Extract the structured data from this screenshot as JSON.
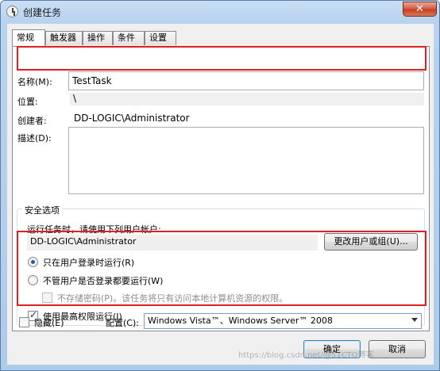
{
  "window": {
    "title": "创建任务",
    "close_label": "✕"
  },
  "tabs": [
    {
      "label": "常规"
    },
    {
      "label": "触发器"
    },
    {
      "label": "操作"
    },
    {
      "label": "条件"
    },
    {
      "label": "设置"
    }
  ],
  "general": {
    "name_label": "名称(M):",
    "name_value": "TestTask",
    "location_label": "位置:",
    "location_value": "\\",
    "author_label": "创建者:",
    "author_value": "DD-LOGIC\\Administrator",
    "description_label": "描述(D):",
    "description_value": ""
  },
  "security": {
    "group_title": "安全选项",
    "run_as_prompt": "运行任务时，请使用下列用户帐户:",
    "account_value": "DD-LOGIC\\Administrator",
    "change_user_button": "更改用户或组(U)...",
    "radio_logged_on": "只在用户登录时运行(R)",
    "radio_whether_logged_on": "不管用户是否登录都要运行(W)",
    "no_store_password": "不存储密码(P)。该任务将只有访问本地计算机资源的权限。",
    "highest_privileges": "使用最高权限运行(I)",
    "radio_logged_on_checked": true,
    "highest_privileges_checked": true
  },
  "footer": {
    "hidden_label": "隐藏(E)",
    "hidden_checked": false,
    "configure_label": "配置(C):",
    "configure_value": "Windows Vista™、Windows Server™ 2008",
    "ok_button": "确定",
    "cancel_button": "取消"
  },
  "watermark": "https://blog.csdn.net/@51CTO博客"
}
